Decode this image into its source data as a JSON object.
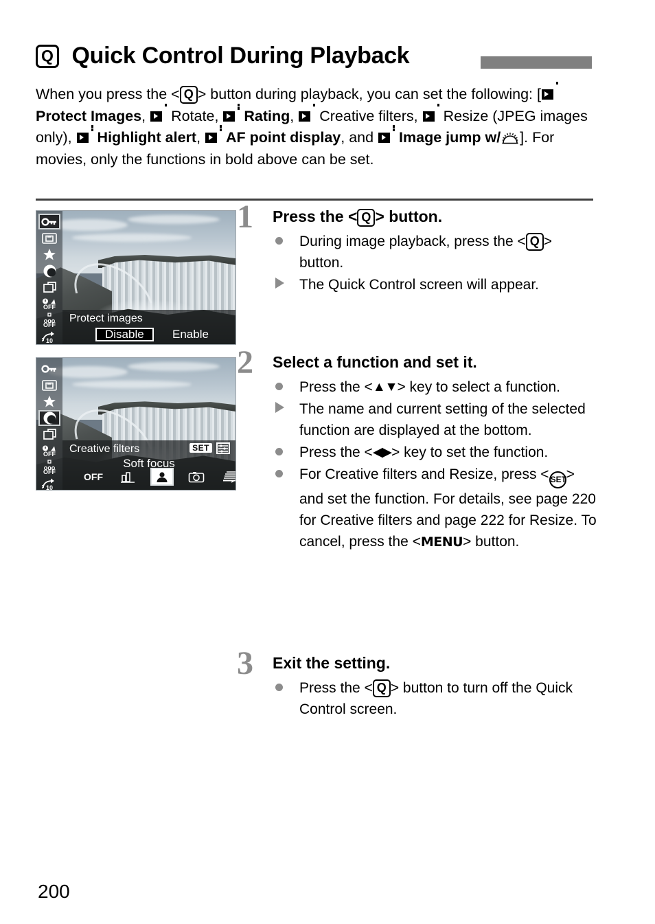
{
  "header": {
    "icon": "quick-control-q-icon",
    "q_label": "Q",
    "title": "Quick Control During Playback",
    "bar_color": "#808080"
  },
  "intro": {
    "part1": "When you press the <",
    "q": "Q",
    "part2": "> button during playback, you can set the",
    "line2_prefix": "following: [",
    "items": [
      {
        "label": "Protect Images",
        "bold": true
      },
      {
        "label": "Rotate",
        "bold": false
      },
      {
        "label": "Rating",
        "bold": true
      },
      {
        "label": "Creative filters",
        "bold": false
      },
      {
        "label": "Resize (JPEG images only)",
        "bold": false
      },
      {
        "label": "Highlight alert",
        "bold": true
      },
      {
        "label": "AF point display",
        "bold": true
      },
      {
        "label": "Image jump w/",
        "bold": true
      }
    ],
    "closing": "]. For movies, only the functions in bold above can be set.",
    "dial_icon": "main-dial-icon"
  },
  "figures": [
    {
      "name": "protect-images-screen",
      "sidebar": [
        {
          "icon": "protect-key-icon",
          "glyph": "—⊙",
          "selected": true
        },
        {
          "icon": "rotate-icon",
          "glyph": "↻",
          "selected": false
        },
        {
          "icon": "rating-star-icon",
          "glyph": "★",
          "selected": false
        },
        {
          "icon": "creative-filters-icon",
          "glyph": "◑",
          "selected": false
        },
        {
          "icon": "resize-icon",
          "glyph": "⬒",
          "selected": false
        },
        {
          "icon": "highlight-alert-icon",
          "glyph": "OFF",
          "selected": false
        },
        {
          "icon": "af-point-display-icon",
          "glyph": "OFF",
          "selected": false
        },
        {
          "icon": "image-jump-icon",
          "glyph": "10",
          "selected": false
        }
      ],
      "function_name": "Protect images",
      "options": [
        {
          "label": "Disable",
          "selected": true
        },
        {
          "label": "Enable",
          "selected": false
        }
      ]
    },
    {
      "name": "creative-filters-screen",
      "sidebar": [
        {
          "icon": "protect-key-icon",
          "glyph": "—⊙",
          "selected": false
        },
        {
          "icon": "rotate-icon",
          "glyph": "↻",
          "selected": false
        },
        {
          "icon": "rating-star-icon",
          "glyph": "★",
          "selected": false
        },
        {
          "icon": "creative-filters-icon",
          "glyph": "◑",
          "selected": true
        },
        {
          "icon": "resize-icon",
          "glyph": "⬒",
          "selected": false
        },
        {
          "icon": "highlight-alert-icon",
          "glyph": "OFF",
          "selected": false
        },
        {
          "icon": "af-point-display-icon",
          "glyph": "OFF",
          "selected": false
        },
        {
          "icon": "image-jump-icon",
          "glyph": "10",
          "selected": false
        }
      ],
      "function_name": "Creative filters",
      "set_badge": "SET",
      "current_value": "Soft focus",
      "filters": [
        {
          "label": "OFF",
          "icon": "filter-off-icon",
          "selected": false
        },
        {
          "label": "",
          "icon": "grainy-bw-icon",
          "selected": false
        },
        {
          "label": "",
          "icon": "soft-focus-portrait-icon",
          "selected": true
        },
        {
          "label": "",
          "icon": "toy-camera-icon",
          "selected": false
        },
        {
          "label": "",
          "icon": "miniature-effect-icon",
          "selected": false
        }
      ]
    }
  ],
  "steps": [
    {
      "number": "1",
      "heading_pre": "Press the <",
      "heading_key": "Q",
      "heading_post": "> button.",
      "bullets": [
        {
          "marker": "dot",
          "pre": "During image playback, press the <",
          "key": "Q",
          "post": "> button."
        },
        {
          "marker": "tri",
          "pre": "The Quick Control screen will appear.",
          "key": "",
          "post": ""
        }
      ]
    },
    {
      "number": "2",
      "heading_pre": "Select a function and set it.",
      "heading_key": "",
      "heading_post": "",
      "bullets": [
        {
          "marker": "dot",
          "pre": "Press the <",
          "key": "▲▼",
          "post": "> key to select a function."
        },
        {
          "marker": "tri",
          "pre": "The name and current setting of the selected function are displayed at the bottom.",
          "key": "",
          "post": ""
        },
        {
          "marker": "dot",
          "pre": "Press the <",
          "key": "◀▶",
          "post": "> key to set the function."
        },
        {
          "marker": "dot",
          "pre": "For Creative filters and Resize, press <",
          "key": "SET",
          "post": "> and set the function. For details, see page 220 for Creative filters and page 222 for Resize. To cancel, press the <MENU> button."
        }
      ]
    },
    {
      "number": "3",
      "heading_pre": "Exit the setting.",
      "heading_key": "",
      "heading_post": "",
      "bullets": [
        {
          "marker": "dot",
          "pre": "Press the <",
          "key": "Q",
          "post": "> button to turn off the Quick Control screen."
        }
      ]
    }
  ],
  "footer": {
    "page_number": "200"
  }
}
